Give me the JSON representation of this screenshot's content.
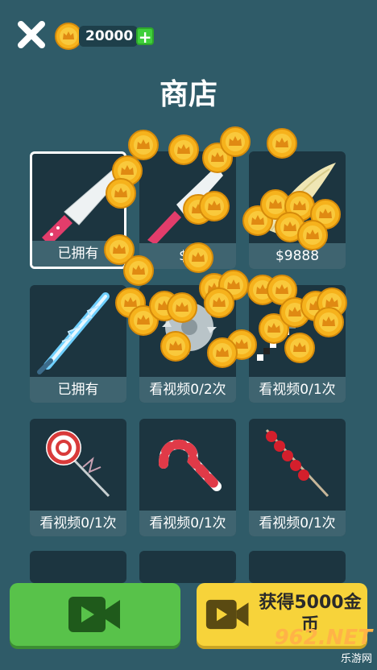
{
  "header": {
    "coin_amount": "20000",
    "plus_label": "+",
    "title": "商店"
  },
  "shop": {
    "items": [
      {
        "label": "已拥有",
        "icon": "kitchen-knife-icon",
        "selected": true
      },
      {
        "label": "$4",
        "icon": "cleaver-knife-icon"
      },
      {
        "label": "$9888",
        "icon": "bone-blade-icon"
      },
      {
        "label": "已拥有",
        "icon": "lightning-sword-icon"
      },
      {
        "label": "看视频0/2次",
        "icon": "saw-blade-icon"
      },
      {
        "label": "看视频0/1次",
        "icon": "pixel-sword-icon"
      },
      {
        "label": "看视频0/1次",
        "icon": "lollipop-icon"
      },
      {
        "label": "看视频0/1次",
        "icon": "candy-cane-icon"
      },
      {
        "label": "看视频0/1次",
        "icon": "tanghulu-icon"
      }
    ]
  },
  "footer": {
    "video_button_icon": "video-camera-icon",
    "coins_button_label": "获得5000金币"
  },
  "watermark": {
    "brand": "962.NET",
    "site": "乐游网"
  },
  "colors": {
    "background": "#2f5b68",
    "card": "#1c3540",
    "label_bar": "#3f6470",
    "green_button": "#58c24a",
    "yellow_button": "#f7d33a",
    "coin": "#f6b21c"
  }
}
